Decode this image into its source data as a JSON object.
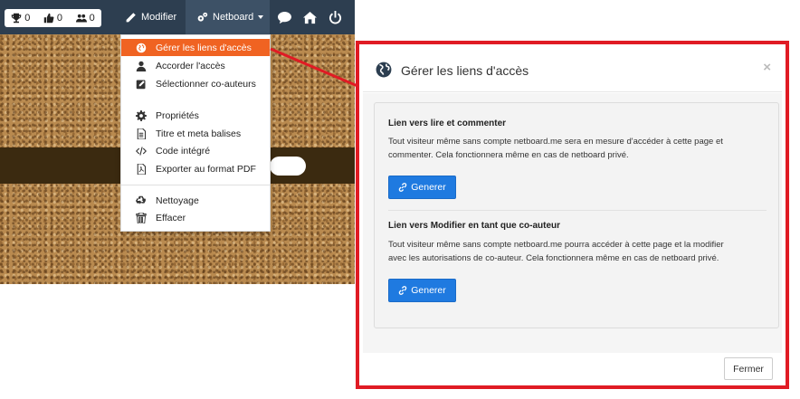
{
  "topbar": {
    "stats": [
      {
        "icon": "trophy-icon",
        "value": "0"
      },
      {
        "icon": "thumbs-up-icon",
        "value": "0"
      },
      {
        "icon": "users-icon",
        "value": "0"
      }
    ],
    "modifier_label": "Modifier",
    "netboard_label": "Netboard",
    "icons": [
      "comment-icon",
      "home-icon",
      "power-icon"
    ]
  },
  "dropdown": {
    "items": [
      {
        "icon": "globe-icon",
        "label": "Gérer les liens d'accès"
      },
      {
        "icon": "user-icon",
        "label": "Accorder l'accès"
      },
      {
        "icon": "edit-icon",
        "label": "Sélectionner co-auteurs"
      },
      {
        "icon": "cog-icon",
        "label": "Propriétés"
      },
      {
        "icon": "file-text-icon",
        "label": "Titre et meta balises"
      },
      {
        "icon": "code-icon",
        "label": "Code intégré"
      },
      {
        "icon": "pdf-icon",
        "label": "Exporter au format PDF"
      },
      {
        "icon": "recycle-icon",
        "label": "Nettoyage"
      },
      {
        "icon": "trash-icon",
        "label": "Effacer"
      }
    ]
  },
  "modal": {
    "title": "Gérer les liens d'accès",
    "close_symbol": "×",
    "section1": {
      "title": "Lien vers lire et commenter",
      "line1": "Tout visiteur même sans compte netboard.me sera en mesure d'accéder à cette page et",
      "line2": "commenter. Cela fonctionnera même en cas de netboard privé.",
      "button": "Generer"
    },
    "section2": {
      "title": "Lien vers Modifier en tant que co-auteur",
      "line1": "Tout visiteur même sans compte netboard.me pourra accéder à cette page et la modifier",
      "line2": "avec les autorisations de co-auteur. Cela fonctionnera même en cas de netboard privé.",
      "button": "Generer"
    },
    "footer_button": "Fermer"
  },
  "colors": {
    "topbar": "#2d3e50",
    "active_item": "#f06322",
    "primary_button": "#1f7ae0",
    "highlight_frame": "#e01b24"
  }
}
